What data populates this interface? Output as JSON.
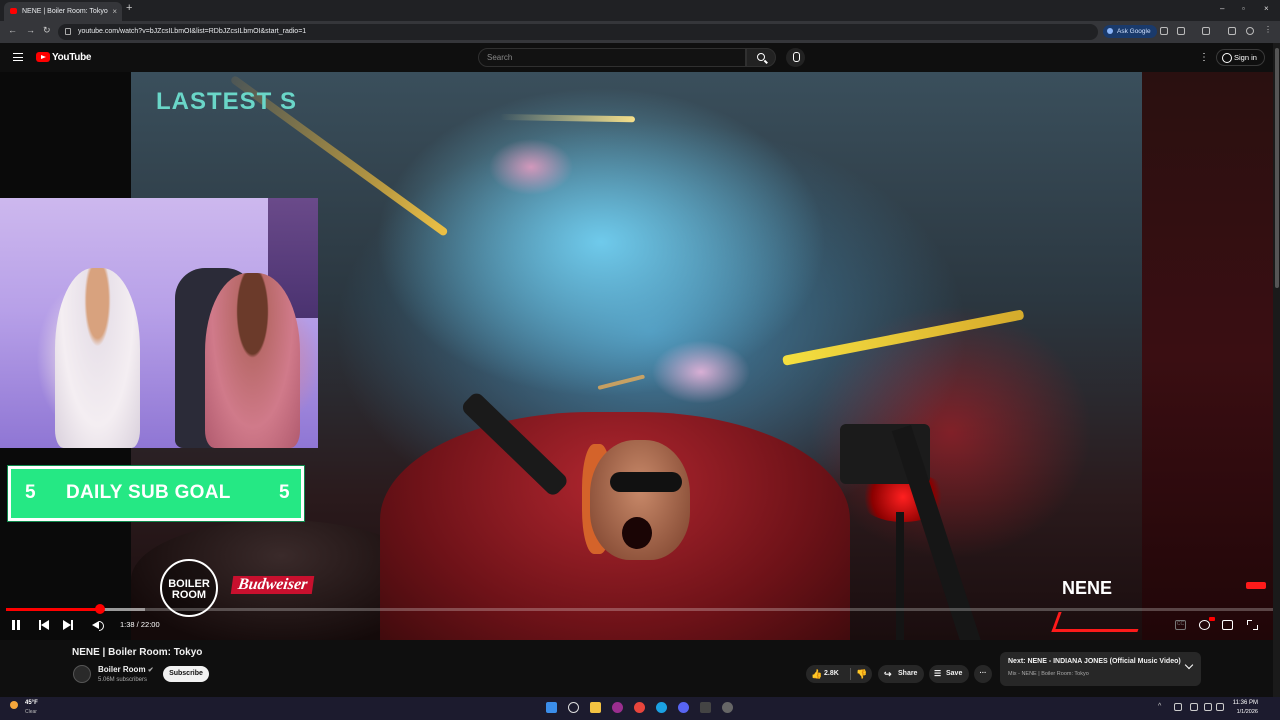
{
  "browser": {
    "tab_title": "NENE | Boiler Room: Tokyo",
    "url": "youtube.com/watch?v=bJZcsILbmOI&list=RDbJZcsILbmOI&start_radio=1",
    "ask_google": "Ask Google"
  },
  "youtube": {
    "brand": "YouTube",
    "search_placeholder": "Search",
    "sign_in": "Sign in"
  },
  "video": {
    "overlay_text": "LASTEST S",
    "sub_goal": {
      "left": "5",
      "label": "DAILY SUB GOAL",
      "right": "5"
    },
    "boiler_room_logo": "BOILER ROOM",
    "sponsor": "Budweiser",
    "artist_name": "NENE",
    "time_display": "1:38 / 22:00",
    "progress_fraction": 0.074,
    "buffered_fraction": 0.11
  },
  "info": {
    "title": "NENE | Boiler Room: Tokyo",
    "channel": "Boiler Room",
    "subscribers": "5.06M subscribers",
    "subscribe_label": "Subscribe",
    "likes": "2.8K",
    "share": "Share",
    "save": "Save",
    "more": "···"
  },
  "up_next": {
    "title": "Next: NENE - INDIANA JONES (Official Music Video)",
    "subtitle": "Mix - NENE | Boiler Room: Tokyo"
  },
  "taskbar": {
    "temperature": "45°F",
    "condition": "Clear",
    "time": "11:36 PM",
    "date": "1/1/2026"
  },
  "colors": {
    "youtube_red": "#ff0000",
    "sub_goal_green": "#25e884",
    "accent_teal": "#6ad6c8"
  }
}
